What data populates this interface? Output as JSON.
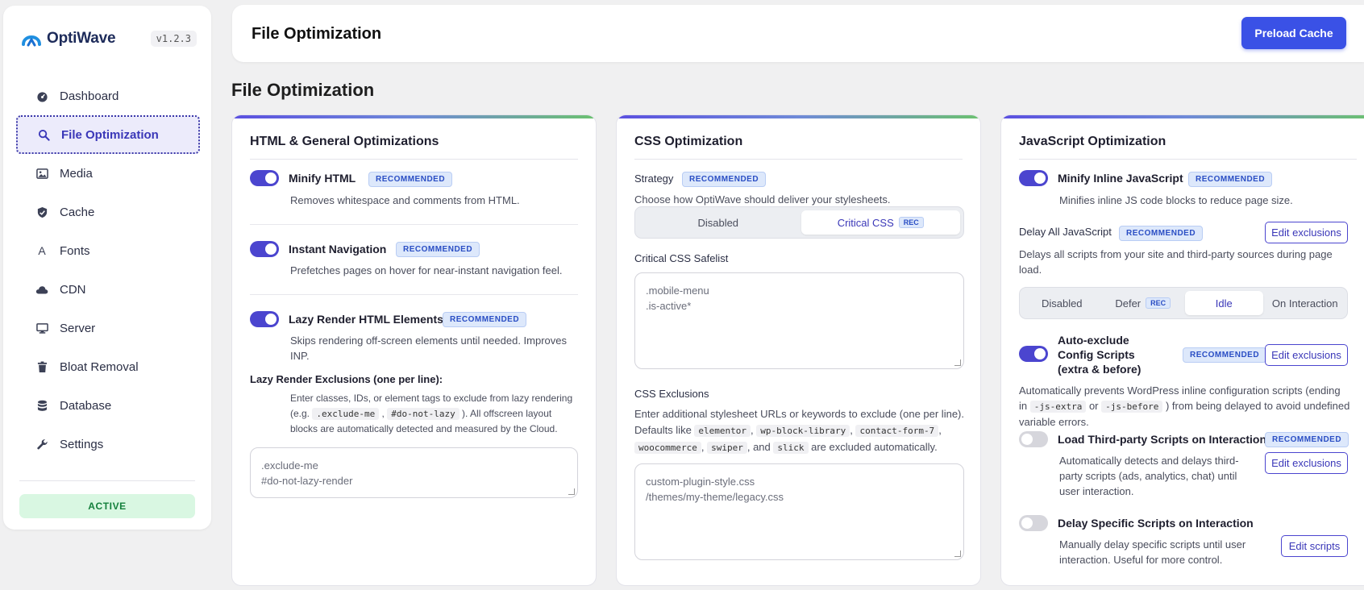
{
  "brand": {
    "name": "OptiWave",
    "version": "v1.2.3"
  },
  "sidebar": {
    "items": [
      {
        "label": "Dashboard",
        "icon": "dashboard-icon"
      },
      {
        "label": "File Optimization",
        "icon": "search-icon",
        "active": true
      },
      {
        "label": "Media",
        "icon": "image-icon"
      },
      {
        "label": "Cache",
        "icon": "cache-icon"
      },
      {
        "label": "Fonts",
        "icon": "font-icon"
      },
      {
        "label": "CDN",
        "icon": "cloud-icon"
      },
      {
        "label": "Server",
        "icon": "monitor-icon"
      },
      {
        "label": "Bloat Removal",
        "icon": "trash-icon"
      },
      {
        "label": "Database",
        "icon": "database-icon"
      },
      {
        "label": "Settings",
        "icon": "wrench-icon"
      }
    ],
    "status": "ACTIVE"
  },
  "header": {
    "title": "File Optimization",
    "preload_label": "Preload Cache"
  },
  "page_title": "File Optimization",
  "html_card": {
    "title": "HTML & General Optimizations",
    "minify": {
      "label": "Minify HTML",
      "badge": "RECOMMENDED",
      "desc": "Removes whitespace and comments from HTML.",
      "enabled": true
    },
    "instant": {
      "label": "Instant Navigation",
      "badge": "RECOMMENDED",
      "desc": "Prefetches pages on hover for near-instant navigation feel.",
      "enabled": true
    },
    "lazy": {
      "label": "Lazy Render HTML Elements",
      "badge": "RECOMMENDED",
      "desc": "Skips rendering off-screen elements until needed. Improves INP.",
      "enabled": true
    },
    "exclusions_label": "Lazy Render Exclusions (one per line):",
    "exclusions_help": {
      "part1": "Enter classes, IDs, or element tags to exclude from lazy rendering (e.g. ",
      "code1": ".exclude-me",
      "sep": " , ",
      "code2": "#do-not-lazy",
      "part2": " ). All offscreen layout blocks are automatically detected and measured by the Cloud."
    },
    "exclusions_value": ".exclude-me\n#do-not-lazy-render"
  },
  "css_card": {
    "title": "CSS Optimization",
    "strategy_label": "Strategy",
    "strategy_badge": "RECOMMENDED",
    "strategy_desc": "Choose how OptiWave should deliver your stylesheets.",
    "strategy_options": [
      {
        "label": "Disabled"
      },
      {
        "label": "Critical CSS",
        "badge": "REC",
        "selected": true
      }
    ],
    "safelist_label": "Critical CSS Safelist",
    "safelist_value": ".mobile-menu\n.is-active*",
    "exclusions_label": "CSS Exclusions",
    "exclusions_help": {
      "part1": "Enter additional stylesheet URLs or keywords to exclude (one per line). Defaults like ",
      "codes": [
        "elementor",
        "wp-block-library",
        "contact-form-7",
        "woocommerce",
        "swiper",
        "slick"
      ],
      "and": ", and",
      "part2": " are excluded automatically."
    },
    "exclusions_value": "custom-plugin-style.css\n/themes/my-theme/legacy.css"
  },
  "js_card": {
    "title": "JavaScript Optimization",
    "minify": {
      "label": "Minify Inline JavaScript",
      "badge": "RECOMMENDED",
      "desc": "Minifies inline JS code blocks to reduce page size.",
      "enabled": true
    },
    "delay_all": {
      "label": "Delay All JavaScript",
      "badge": "RECOMMENDED",
      "button": "Edit exclusions",
      "desc": "Delays all scripts from your site and third-party sources during page load.",
      "options": [
        {
          "label": "Disabled"
        },
        {
          "label": "Defer",
          "badge": "REC"
        },
        {
          "label": "Idle",
          "selected": true
        },
        {
          "label": "On Interaction"
        }
      ]
    },
    "auto_exclude": {
      "label": "Auto-exclude Config Scripts (extra & before)",
      "badge": "RECOMMENDED",
      "button": "Edit exclusions",
      "enabled": true,
      "desc_part1": "Automatically prevents WordPress inline configuration scripts (ending in ",
      "code1": "-js-extra",
      "or": " or ",
      "code2": "-js-before",
      "desc_part2": " ) from being delayed to avoid undefined variable errors."
    },
    "third_party": {
      "label": "Load Third-party Scripts on Interaction",
      "badge": "RECOMMENDED",
      "button": "Edit exclusions",
      "enabled": false,
      "desc": "Automatically detects and delays third-party scripts (ads, analytics, chat) until user interaction."
    },
    "delay_specific": {
      "label": "Delay Specific Scripts on Interaction",
      "button": "Edit scripts",
      "enabled": false,
      "desc": "Manually delay specific scripts until user interaction. Useful for more control."
    }
  },
  "colors": {
    "accent": "#4b45cf",
    "primary_button": "#3a51e6",
    "badge_bg": "#dde8fb",
    "active_bg": "#d9f7e2"
  }
}
